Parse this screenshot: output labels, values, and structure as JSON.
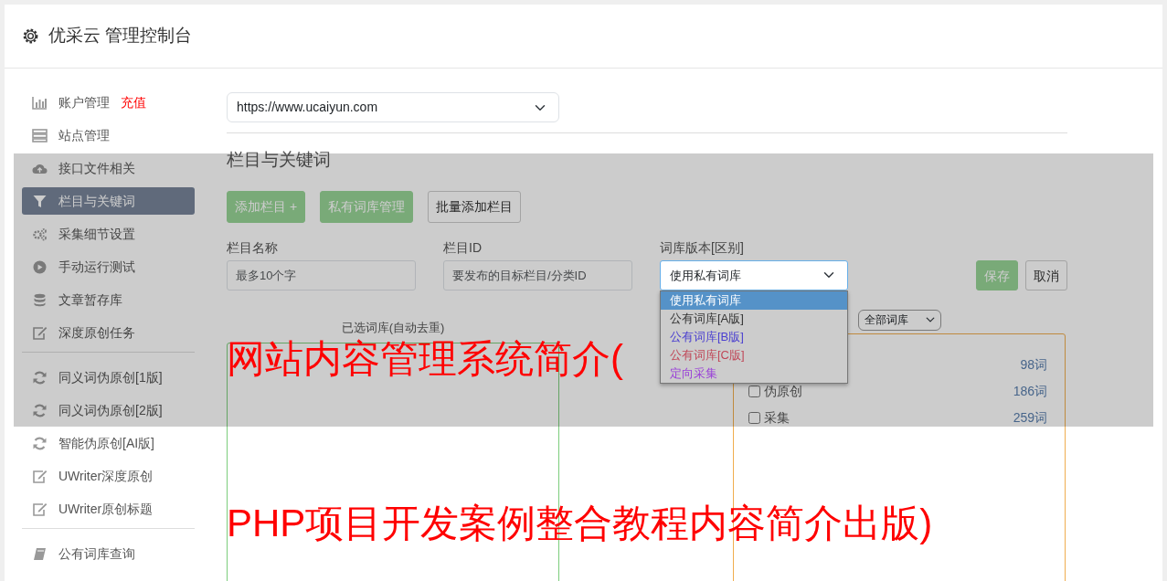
{
  "header": {
    "title": "优采云 管理控制台"
  },
  "sidebar": {
    "groups": [
      {
        "items": [
          {
            "label": "账户管理",
            "badge": "充值",
            "selected": false
          },
          {
            "label": "站点管理",
            "selected": false
          },
          {
            "label": "接口文件相关",
            "selected": false
          },
          {
            "label": "栏目与关键词",
            "selected": true
          },
          {
            "label": "采集细节设置",
            "selected": false
          },
          {
            "label": "手动运行测试",
            "selected": false
          },
          {
            "label": "文章暂存库",
            "selected": false
          },
          {
            "label": "深度原创任务",
            "selected": false
          }
        ]
      },
      {
        "items": [
          {
            "label": "同义词伪原创[1版]",
            "selected": false
          },
          {
            "label": "同义词伪原创[2版]",
            "selected": false
          },
          {
            "label": "智能伪原创[AI版]",
            "selected": false
          },
          {
            "label": "UWriter深度原创",
            "selected": false
          },
          {
            "label": "UWriter原创标题",
            "selected": false
          }
        ]
      },
      {
        "items": [
          {
            "label": "公有词库查询",
            "selected": false
          }
        ]
      }
    ]
  },
  "main": {
    "site_select": {
      "value": "https://www.ucaiyun.com"
    },
    "section_title": "栏目与关键词",
    "toolbar": [
      {
        "label": "添加栏目 +",
        "kind": "success"
      },
      {
        "label": "私有词库管理",
        "kind": "success"
      },
      {
        "label": "批量添加栏目",
        "kind": "outline"
      }
    ],
    "fields": [
      {
        "label": "栏目名称",
        "placeholder": "最多10个字"
      },
      {
        "label": "栏目ID",
        "placeholder": "要发布的目标栏目/分类ID"
      }
    ],
    "library_version": {
      "label": "词库版本[区别]",
      "value": "使用私有词库",
      "expanded": true,
      "options": [
        {
          "label": "使用私有词库",
          "selected": true
        },
        {
          "label": "公有词库[A版]",
          "selected": false
        },
        {
          "label": "公有词库[B版]",
          "selected": false,
          "color": "#4a3fd0"
        },
        {
          "label": "公有词库[C版]",
          "selected": false,
          "color": "#c04858"
        },
        {
          "label": "定向采集",
          "selected": false,
          "color": "#9a40d8"
        }
      ]
    },
    "actions": [
      {
        "label": "保存",
        "kind": "success"
      },
      {
        "label": "取消",
        "kind": "outline"
      }
    ],
    "selected_panel": {
      "title": "已选词库(自动去重)"
    },
    "library_filter": {
      "value": "全部词库"
    },
    "libraries": [
      {
        "count": "98词"
      },
      {
        "label": "伪原创",
        "checked": false,
        "count": "186词"
      },
      {
        "label": "采集",
        "checked": false,
        "count": "259词"
      }
    ]
  },
  "overlay_captions": [
    "网站内容管理系统简介(",
    "PHP项目开发案例整合教程内容简介出版)"
  ]
}
